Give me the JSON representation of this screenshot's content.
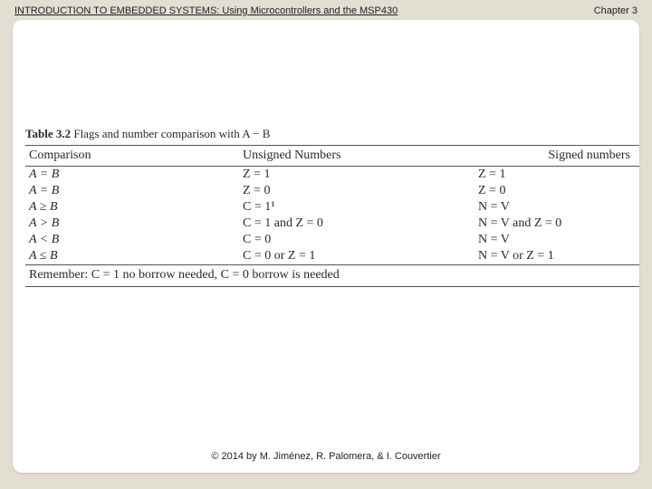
{
  "header": {
    "title": "INTRODUCTION TO EMBEDDED SYSTEMS: Using Microcontrollers and the MSP430",
    "chapter": "Chapter 3"
  },
  "table": {
    "caption_label": "Table 3.2",
    "caption_text": "Flags and number comparison with A − B",
    "columns": {
      "c1": "Comparison",
      "c2": "Unsigned Numbers",
      "c3": "Signed numbers"
    },
    "rows": [
      {
        "c1": "A =  B",
        "c2": "Z = 1",
        "c3": "Z = 1"
      },
      {
        "c1": "A =  B",
        "c2": "Z = 0",
        "c3": "Z = 0"
      },
      {
        "c1": "A ≥  B",
        "c2": "C = 1¹",
        "c3": "N = V"
      },
      {
        "c1": "A >  B",
        "c2": "C = 1 and Z = 0",
        "c3": "N = V and Z = 0"
      },
      {
        "c1": "A <  B",
        "c2": "C = 0",
        "c3": "N = V"
      },
      {
        "c1": "A ≤  B",
        "c2": "C = 0 or Z = 1",
        "c3": "N = V or Z = 1"
      }
    ],
    "footnote": "Remember: C = 1 no borrow needed, C = 0 borrow is needed"
  },
  "footer": {
    "copyright": "© 2014 by M. Jiménez, R. Palomera, & I. Couvertier"
  }
}
